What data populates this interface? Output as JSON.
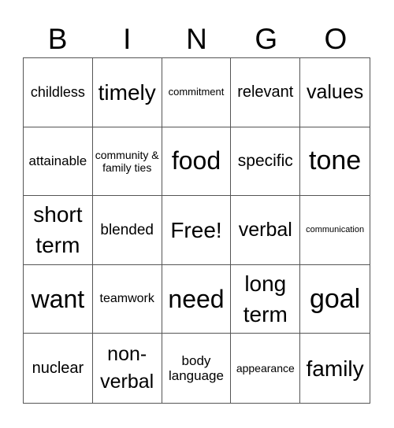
{
  "header": [
    "B",
    "I",
    "N",
    "G",
    "O"
  ],
  "cells": [
    {
      "text": "childless",
      "size": "s18"
    },
    {
      "text": "timely",
      "size": "s28"
    },
    {
      "text": "commitment",
      "size": "s13"
    },
    {
      "text": "relevant",
      "size": "s20"
    },
    {
      "text": "values",
      "size": "s25"
    },
    {
      "text": "attainable",
      "size": "s17"
    },
    {
      "text": "community & family ties",
      "size": "s14"
    },
    {
      "text": "food",
      "size": "s32"
    },
    {
      "text": "specific",
      "size": "s21"
    },
    {
      "text": "tone",
      "size": "s34"
    },
    {
      "text": "short term",
      "size": "s28"
    },
    {
      "text": "blended",
      "size": "s19"
    },
    {
      "text": "Free!",
      "size": "s28"
    },
    {
      "text": "verbal",
      "size": "s25"
    },
    {
      "text": "communication",
      "size": "s11"
    },
    {
      "text": "want",
      "size": "s32"
    },
    {
      "text": "teamwork",
      "size": "s16"
    },
    {
      "text": "need",
      "size": "s32"
    },
    {
      "text": "long term",
      "size": "s28"
    },
    {
      "text": "goal",
      "size": "s34"
    },
    {
      "text": "nuclear",
      "size": "s20"
    },
    {
      "text": "non-verbal",
      "size": "s25"
    },
    {
      "text": "body language",
      "size": "s17"
    },
    {
      "text": "appearance",
      "size": "s14"
    },
    {
      "text": "family",
      "size": "s28"
    }
  ]
}
